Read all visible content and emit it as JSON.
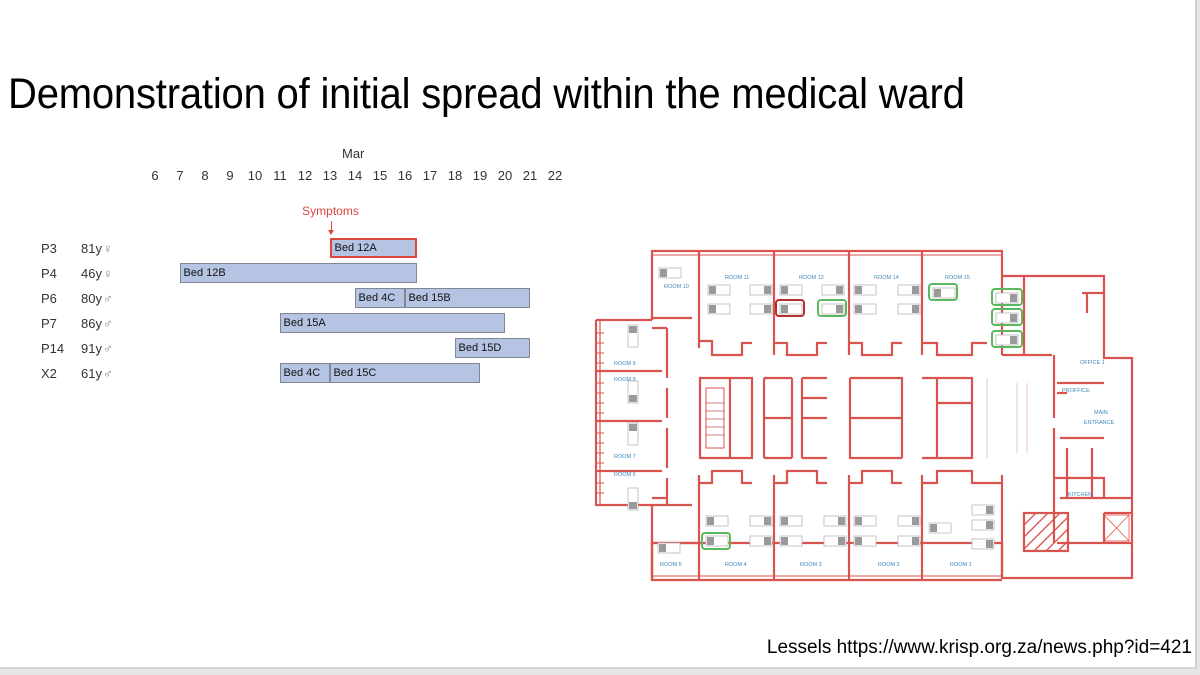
{
  "slide": {
    "title": "Demonstration of initial spread within the medical ward",
    "citation": "Lessels https://www.krisp.org.za/news.php?id=421"
  },
  "timeline": {
    "month": "Mar",
    "days": [
      "6",
      "7",
      "8",
      "9",
      "10",
      "11",
      "12",
      "13",
      "14",
      "15",
      "16",
      "17",
      "18",
      "19",
      "20",
      "21",
      "22"
    ],
    "symptoms_label": "Symptoms",
    "symptoms_day": 13,
    "colors": {
      "bar_fill": "#b6c4e3",
      "bar_border": "#7f8797",
      "highlight": "#d9473e"
    },
    "patients": [
      {
        "id": "P3",
        "age": "81y",
        "sex": "female",
        "sex_icon": "♀",
        "stays": [
          {
            "label": "Bed 12A",
            "start": 13,
            "end": 16.5,
            "highlight": true
          }
        ]
      },
      {
        "id": "P4",
        "age": "46y",
        "sex": "female",
        "sex_icon": "♀",
        "stays": [
          {
            "label": "Bed 12B",
            "start": 7,
            "end": 16.5,
            "highlight": false
          }
        ]
      },
      {
        "id": "P6",
        "age": "80y",
        "sex": "male",
        "sex_icon": "♂",
        "stays": [
          {
            "label": "Bed 4C",
            "start": 14,
            "end": 16,
            "highlight": false
          },
          {
            "label": "Bed 15B",
            "start": 16,
            "end": 21,
            "highlight": false
          }
        ]
      },
      {
        "id": "P7",
        "age": "86y",
        "sex": "male",
        "sex_icon": "♂",
        "stays": [
          {
            "label": "Bed 15A",
            "start": 11,
            "end": 20,
            "highlight": false
          }
        ]
      },
      {
        "id": "P14",
        "age": "91y",
        "sex": "male",
        "sex_icon": "♂",
        "stays": [
          {
            "label": "Bed 15D",
            "start": 18,
            "end": 21,
            "highlight": false
          }
        ]
      },
      {
        "id": "X2",
        "age": "61y",
        "sex": "male",
        "sex_icon": "♂",
        "stays": [
          {
            "label": "Bed 4C",
            "start": 11,
            "end": 13,
            "highlight": false
          },
          {
            "label": "Bed 15C",
            "start": 13,
            "end": 19,
            "highlight": false
          }
        ]
      }
    ]
  },
  "floorplan": {
    "colors": {
      "wall": "#d9534f",
      "label": "#3e86b9",
      "bed_positive": "#d64541",
      "bed_highlight_green": "#5cb85c",
      "bed": "#9a9a9a"
    },
    "rooms": {
      "room1": "ROOM 1",
      "room2": "ROOM 2",
      "room3": "ROOM 3",
      "room4": "ROOM 4",
      "room5": "ROOM 5",
      "room6": "ROOM 6",
      "room7": "ROOM 7",
      "room8": "ROOM 8",
      "room9": "ROOM 9",
      "room10": "ROOM 10",
      "room11": "ROOM 11",
      "room12": "ROOM 12",
      "room14": "ROOM 14",
      "room15": "ROOM 15",
      "office1": "OFFICE 1",
      "proffice": "PROFFICE",
      "main_entrance_1": "MAIN",
      "main_entrance_2": "ENTRANCE",
      "kitchen": "KITCHEN"
    }
  }
}
